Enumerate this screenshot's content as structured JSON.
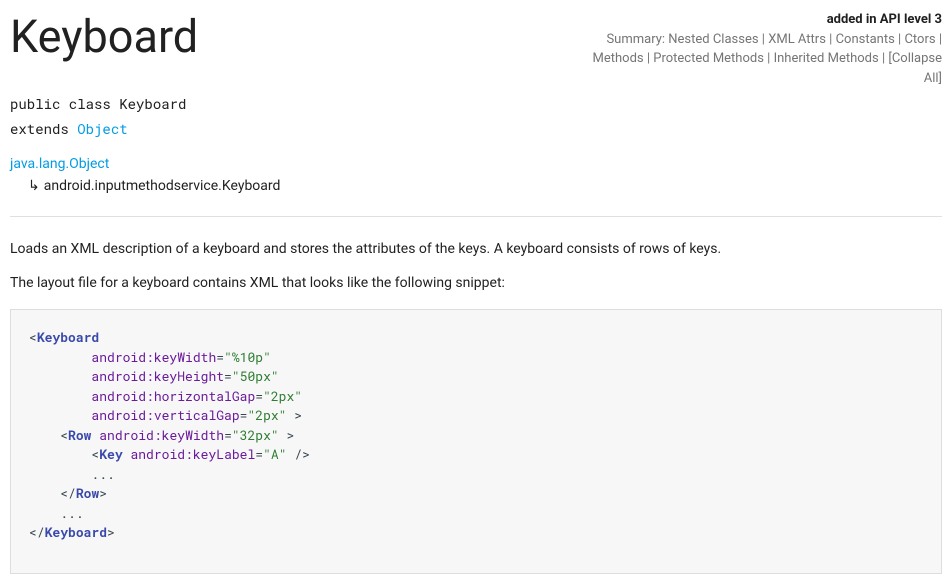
{
  "header": {
    "title": "Keyboard",
    "api_added": "added in API level 3",
    "summary_label": "Summary:",
    "links": [
      "Nested Classes",
      "XML Attrs",
      "Constants",
      "Ctors",
      "Methods",
      "Protected Methods",
      "Inherited Methods",
      "[Collapse All]"
    ]
  },
  "signature": {
    "line1_a": "public class ",
    "line1_b": "Keyboard",
    "line2_a": "extends ",
    "line2_link": "Object"
  },
  "hierarchy": {
    "l1": "java.lang.Object",
    "l2": "android.inputmethodservice.Keyboard"
  },
  "desc": {
    "p1": "Loads an XML description of a keyboard and stores the attributes of the keys. A keyboard consists of rows of keys.",
    "p2": "The layout file for a keyboard contains XML that looks like the following snippet:"
  },
  "code": {
    "open_ang": "<",
    "close_ang": ">",
    "slash": "/",
    "eq": "=",
    "kbd": "Keyboard",
    "row": "Row",
    "key": "Key",
    "a_kw": "android:keyWidth",
    "a_kh": "android:keyHeight",
    "a_hg": "android:horizontalGap",
    "a_vg": "android:verticalGap",
    "a_kl": "android:keyLabel",
    "v_kw": "\"%10p\"",
    "v_kh": "\"50px\"",
    "v_hg": "\"2px\"",
    "v_vg": "\"2px\"",
    "v_rkw": "\"32px\"",
    "v_kl": "\"A\"",
    "sp": " ",
    "ellip": "...",
    "i8": "        ",
    "i4": "    ",
    "i12": "            "
  }
}
